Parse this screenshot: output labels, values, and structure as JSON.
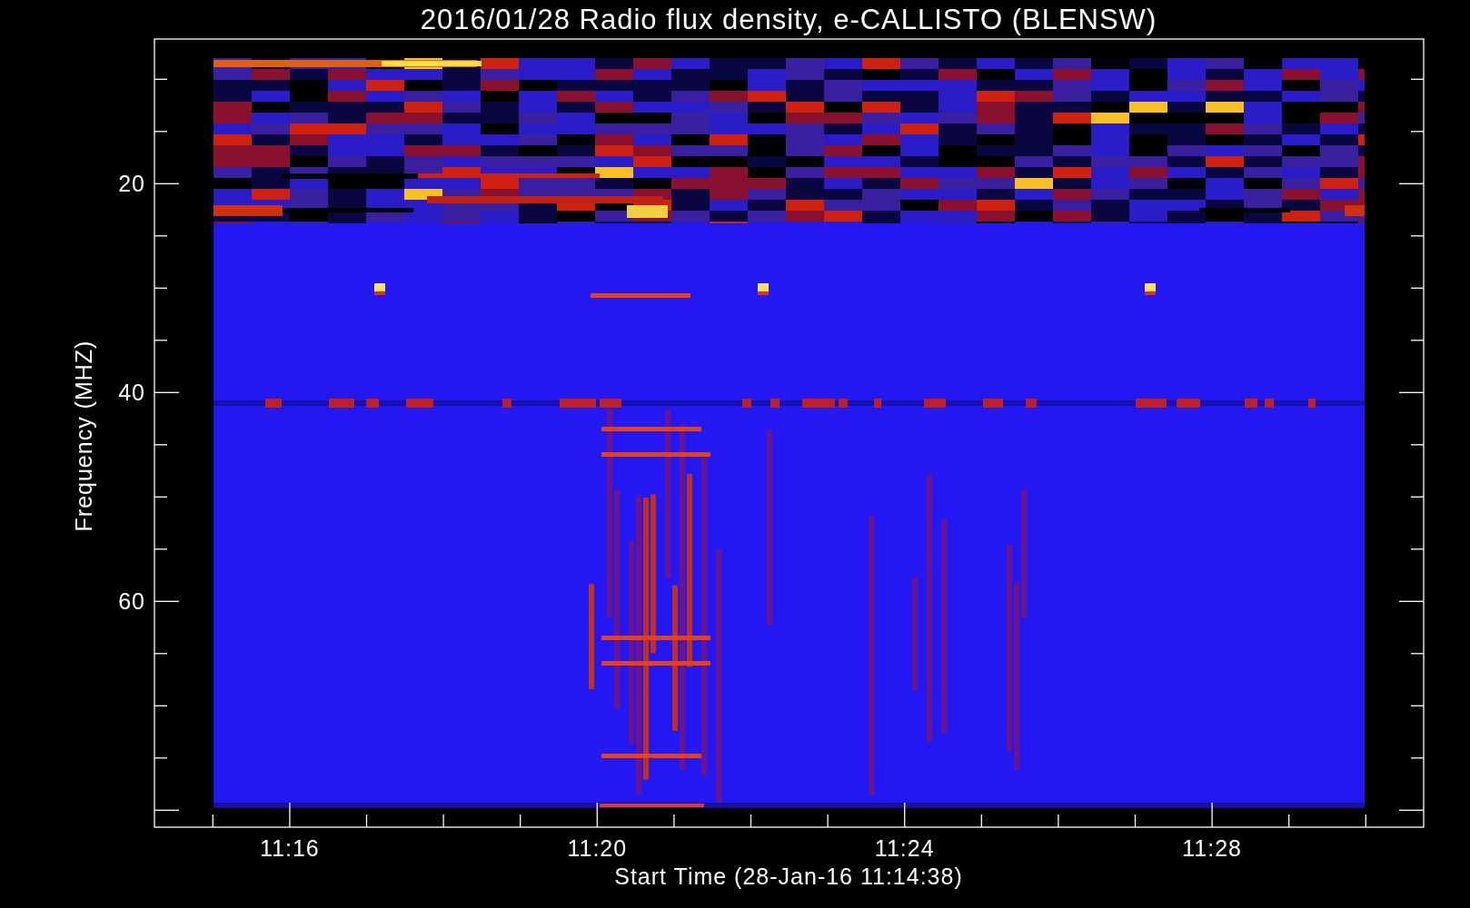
{
  "plot": {
    "title": "2016/01/28  Radio flux density, e-CALLISTO (BLENSW)",
    "ylabel": "Frequency (MHZ)",
    "xlabel": "Start Time (28-Jan-16 11:14:38)",
    "yticks": [
      "20",
      "40",
      "60"
    ],
    "xticks": [
      "11:16",
      "11:20",
      "11:24",
      "11:28"
    ]
  }
}
